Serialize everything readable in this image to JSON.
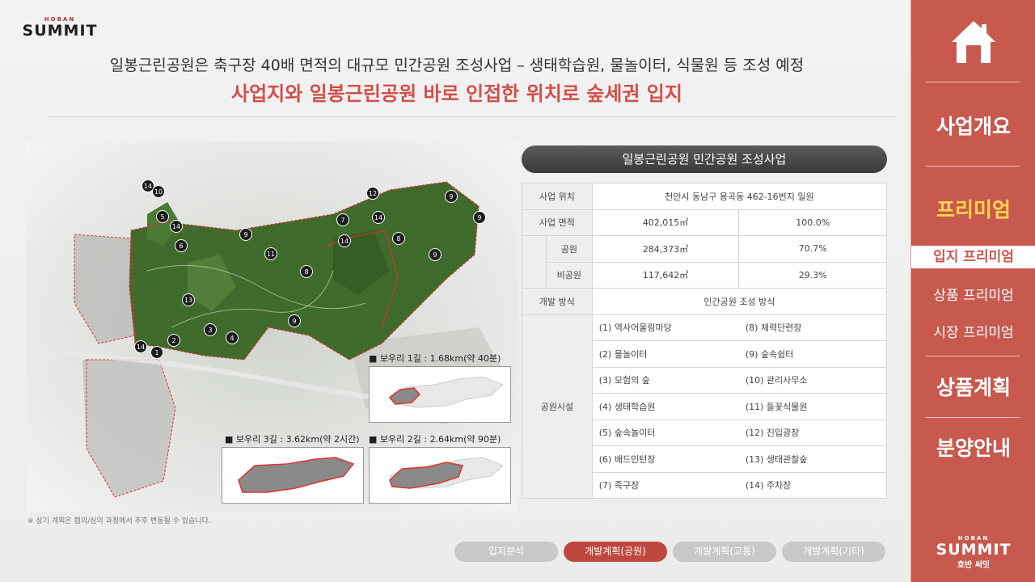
{
  "brand": {
    "top_small": "HOBAN",
    "top_big": "SUMMIT",
    "side_small": "HOBAN",
    "side_big": "SUMMIT",
    "side_sub": "호반 써밋"
  },
  "heading": {
    "line1": "일봉근린공원은 축구장 40배 면적의 대규모 민간공원 조성사업 – 생태학습원, 물놀이터, 식물원 등 조성 예정",
    "line2": "사업지와 일봉근린공원 바로 인접한 위치로 숲세권 입지"
  },
  "map": {
    "markers": [
      "14",
      "10",
      "5",
      "14",
      "6",
      "9",
      "11",
      "13",
      "8",
      "7",
      "14",
      "12",
      "9",
      "9",
      "8",
      "9",
      "14",
      "9",
      "3",
      "4",
      "2",
      "1",
      "14"
    ],
    "trails": [
      {
        "label": "■ 보우리 1길 : 1.68km(약 40분)"
      },
      {
        "label": "■ 보우리 3길 : 3.62km(약 2시간)"
      },
      {
        "label": "■ 보우리 2길 : 2.64km(약 90분)"
      }
    ],
    "footnote": "※ 상기 계획은 협의/심의 과정에서 추후 변동될 수 있습니다."
  },
  "table": {
    "title": "일봉근린공원 민간공원 조성사업",
    "location_label": "사업 위치",
    "location_value": "천안시 동남구 용곡동 462-16번지 일원",
    "area_label": "사업 면적",
    "area_value": "402,015㎡",
    "area_pct": "100.0%",
    "park_label": "공원",
    "park_value": "284,373㎡",
    "park_pct": "70.7%",
    "nonpark_label": "비공원",
    "nonpark_value": "117,642㎡",
    "nonpark_pct": "29.3%",
    "method_label": "개발 방식",
    "method_value": "민간공원 조성 방식",
    "facilities_label": "공원시설",
    "facilities_left": [
      "(1)   역사어울림마당",
      "(2)   물놀이터",
      "(3)   모험의 숲",
      "(4)   생태학습원",
      "(5)   숲속놀이터",
      "(6)   배드민턴장",
      "(7)   족구장"
    ],
    "facilities_right": [
      "(8)   체력단련장",
      "(9)   숲속쉼터",
      "(10)   관리사무소",
      "(11)   들꽃식물원",
      "(12)   진입광장",
      "(13)   생태관찰숲",
      "(14)   주차장"
    ]
  },
  "tabs": [
    "입지분석",
    "개발계획(공원)",
    "개발계획(교통)",
    "개발계획(기타)"
  ],
  "sidebar": {
    "nav1": "사업개요",
    "nav2": "프리미엄",
    "sub1": "입지 프리미엄",
    "sub2": "상품 프리미엄",
    "sub3": "시장 프리미엄",
    "nav3": "상품계획",
    "nav4": "분양안내"
  },
  "colors": {
    "accent": "#c7594e",
    "headline_red": "#d14f4a",
    "active_nav": "#ffd54f",
    "forest": "#3f6b2c"
  }
}
